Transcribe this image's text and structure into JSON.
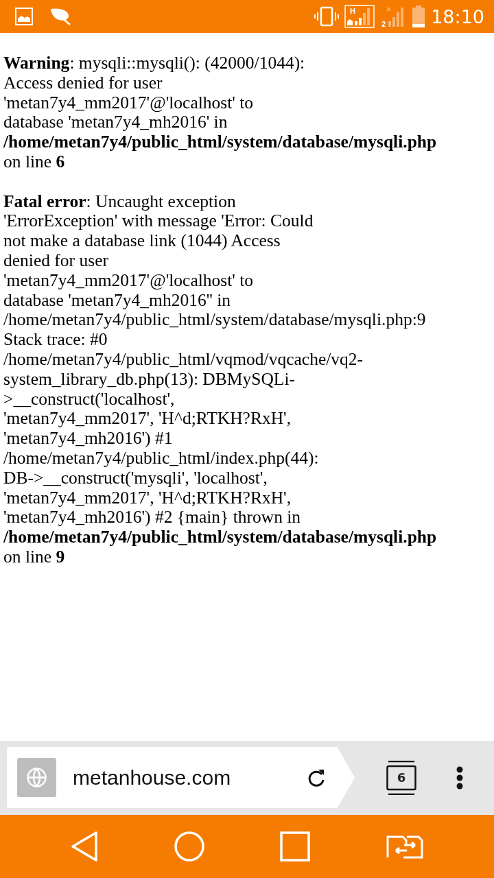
{
  "status_bar": {
    "network_label": "H",
    "sim_label": "2",
    "time": "18:10"
  },
  "messages": [
    {
      "text": "**Warning**: mysqli::mysqli(): (42000/1044):\nAccess denied for user\n'metan7y4_mm2017'@'localhost' to\ndatabase 'metan7y4_mh2016' in\n**/home/metan7y4/public_html/system/database/mysqli.php**\non line **6**"
    },
    {
      "text": "**Fatal error**: Uncaught exception\n'ErrorException' with message 'Error: Could\nnot make a database link (1044) Access\ndenied for user\n'metan7y4_mm2017'@'localhost' to\ndatabase 'metan7y4_mh2016'' in\n/home/metan7y4/public_html/system/database/mysqli.php:9\nStack trace: #0\n/home/metan7y4/public_html/vqmod/vqcache/vq2-\nsystem_library_db.php(13): DBMySQLi-\n>__construct('localhost',\n'metan7y4_mm2017', 'H^d;RTKH?RxH',\n'metan7y4_mh2016') #1\n/home/metan7y4/public_html/index.php(44):\nDB->__construct('mysqli', 'localhost',\n'metan7y4_mm2017', 'H^d;RTKH?RxH',\n'metan7y4_mh2016') #2 {main} thrown in\n**/home/metan7y4/public_html/system/database/mysqli.php**\non line **9**"
    }
  ],
  "browser_bar": {
    "url": "metanhouse.com",
    "tab_count": "6"
  }
}
